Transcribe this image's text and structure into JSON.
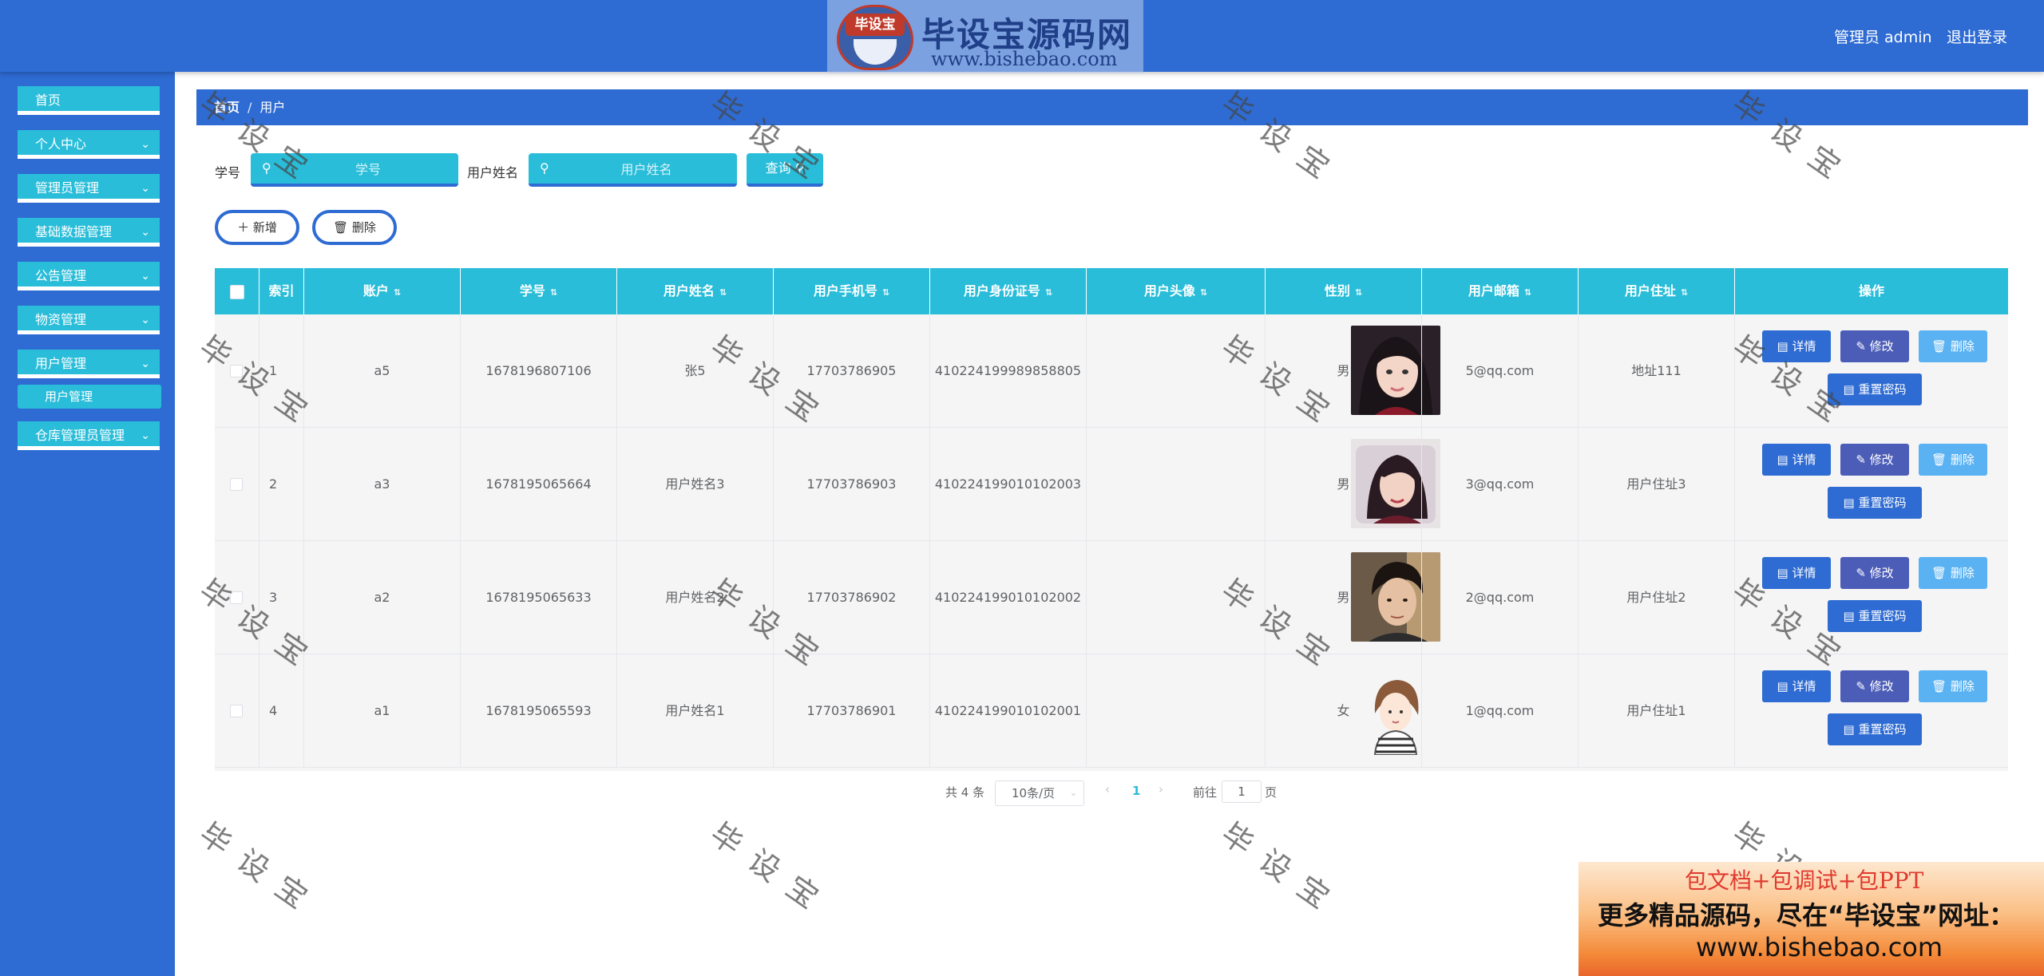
{
  "header": {
    "logo_seal": "毕设宝",
    "logo_title": "毕设宝源码网",
    "logo_url": "www.bishebao.com",
    "admin_label": "管理员 admin",
    "logout_label": "退出登录"
  },
  "sidebar": {
    "items": [
      {
        "label": "首页"
      },
      {
        "label": "个人中心"
      },
      {
        "label": "管理员管理"
      },
      {
        "label": "基础数据管理"
      },
      {
        "label": "公告管理"
      },
      {
        "label": "物资管理"
      },
      {
        "label": "用户管理"
      },
      {
        "label": "仓库管理员管理"
      }
    ],
    "sub_item": "用户管理"
  },
  "breadcrumb": {
    "home": "首页",
    "separator": "/",
    "current": "用户"
  },
  "search": {
    "student_id_label": "学号",
    "student_id_placeholder": "学号",
    "name_label": "用户姓名",
    "name_placeholder": "用户姓名",
    "query_label": "查询"
  },
  "actions": {
    "add_label": "新增",
    "delete_label": "删除"
  },
  "table": {
    "headers": [
      "索引",
      "账户",
      "学号",
      "用户姓名",
      "用户手机号",
      "用户身份证号",
      "用户头像",
      "性别",
      "用户邮箱",
      "用户住址",
      "操作"
    ],
    "rows": [
      {
        "index": "1",
        "account": "a5",
        "student_id": "1678196807106",
        "name": "张5",
        "phone": "17703786905",
        "id_card": "410224199989858805",
        "gender": "男",
        "email": "5@qq.com",
        "address": "地址111"
      },
      {
        "index": "2",
        "account": "a3",
        "student_id": "1678195065664",
        "name": "用户姓名3",
        "phone": "17703786903",
        "id_card": "410224199010102003",
        "gender": "男",
        "email": "3@qq.com",
        "address": "用户住址3"
      },
      {
        "index": "3",
        "account": "a2",
        "student_id": "1678195065633",
        "name": "用户姓名2",
        "phone": "17703786902",
        "id_card": "410224199010102002",
        "gender": "男",
        "email": "2@qq.com",
        "address": "用户住址2"
      },
      {
        "index": "4",
        "account": "a1",
        "student_id": "1678195065593",
        "name": "用户姓名1",
        "phone": "17703786901",
        "id_card": "410224199010102001",
        "gender": "女",
        "email": "1@qq.com",
        "address": "用户住址1"
      }
    ],
    "row_actions": {
      "detail": "详情",
      "edit": "修改",
      "delete": "删除",
      "reset": "重置密码"
    }
  },
  "pagination": {
    "total": "共 4 条",
    "page_size": "10条/页",
    "current_page": "1",
    "goto_label": "前往",
    "goto_value": "1",
    "page_suffix": "页"
  },
  "watermark": "毕设宝",
  "ad": {
    "line1": "包文档+包调试+包PPT",
    "line2": "更多精品源码，尽在“毕设宝”网址：",
    "line3": "www.bishebao.com"
  },
  "colors": {
    "primary_blue": "#2e6bd3",
    "cyan": "#29bdd9",
    "edit_purple": "#4c5db8",
    "delete_light_blue": "#5ab2f2"
  }
}
